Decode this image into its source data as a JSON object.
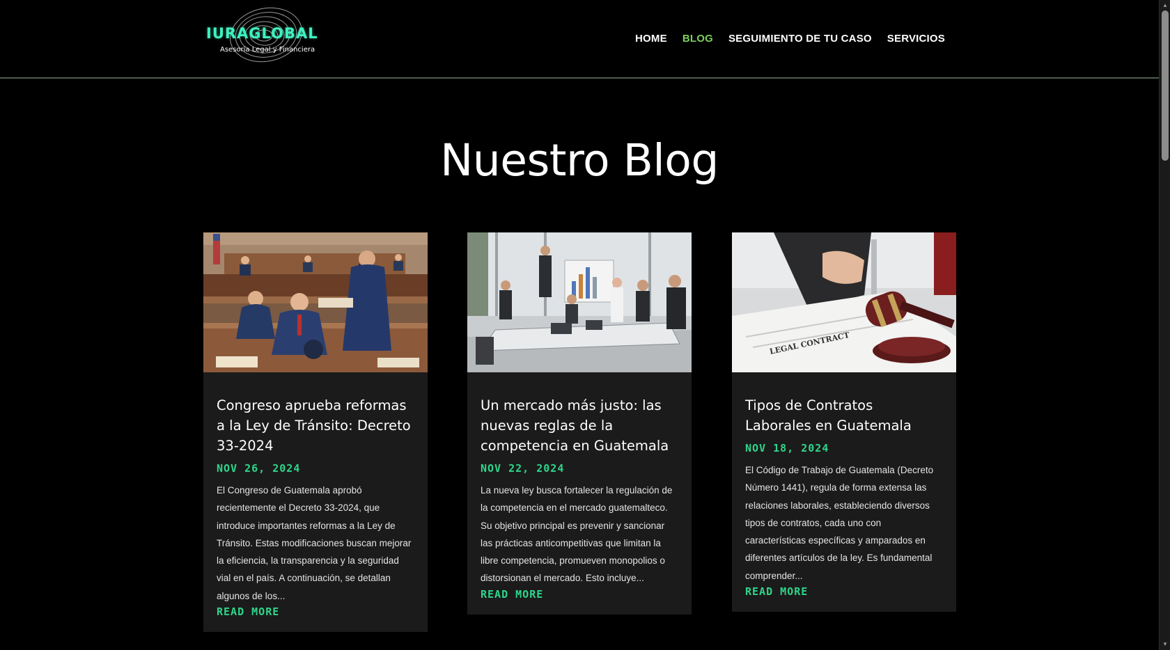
{
  "header": {
    "logo": {
      "name": "IURAGLOBAL",
      "tagline": "Asesoría Legal y Financiera"
    },
    "nav": [
      {
        "label": "HOME",
        "active": false
      },
      {
        "label": "BLOG",
        "active": true
      },
      {
        "label": "SEGUIMIENTO DE TU CASO",
        "active": false
      },
      {
        "label": "SERVICIOS",
        "active": false
      }
    ]
  },
  "main": {
    "title": "Nuestro Blog",
    "posts": [
      {
        "image": "courtroom-illustration",
        "title": "Congreso aprueba reformas a la Ley de Tránsito: Decreto 33-2024",
        "date": "NOV 26, 2024",
        "excerpt": "El Congreso de Guatemala aprobó recientemente el Decreto 33-2024, que introduce importantes reformas a la Ley de Tránsito. Estas modificaciones buscan mejorar la eficiencia, la transparencia y la seguridad vial en el país. A continuación, se detallan algunos de los...",
        "read_more": "READ MORE"
      },
      {
        "image": "business-meeting-photo",
        "title": "Un mercado más justo: las nuevas reglas de la competencia en Guatemala",
        "date": "NOV 22, 2024",
        "excerpt": "La nueva ley busca fortalecer la regulación de la competencia en el mercado guatemalteco. Su objetivo principal es prevenir y sancionar las prácticas anticompetitivas que limitan la libre competencia, promueven monopolios o distorsionan el mercado. Esto incluye...",
        "read_more": "READ MORE"
      },
      {
        "image": "legal-contract-gavel-photo",
        "title": "Tipos de Contratos Laborales en Guatemala",
        "date": "NOV 18, 2024",
        "excerpt": "El Código de Trabajo de Guatemala (Decreto Número 1441), regula de forma extensa las relaciones laborales, estableciendo diversos tipos de contratos, cada uno con características específicas y amparados en diferentes artículos de la ley. Es fundamental comprender...",
        "read_more": "READ MORE",
        "image_text": "LEGAL CONTRACT"
      }
    ]
  },
  "colors": {
    "background": "#000000",
    "card": "#1b1b1b",
    "accent_green": "#2fd58a",
    "nav_active": "#7ecf5e",
    "logo_teal": "#3ff0c0"
  }
}
